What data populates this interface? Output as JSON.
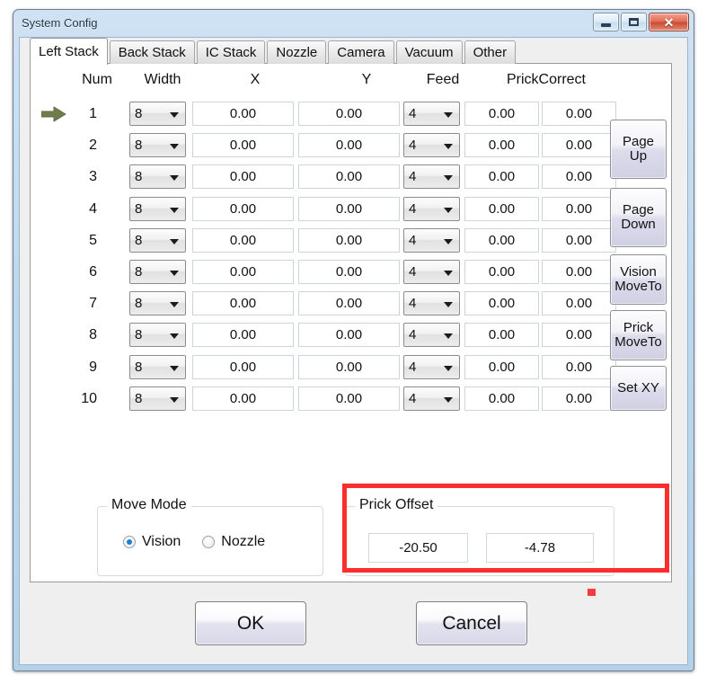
{
  "window": {
    "title": "System Config",
    "controls": {
      "minimize_label": "Minimize",
      "maximize_label": "Maximize",
      "close_label": "✕"
    }
  },
  "tabs": [
    {
      "label": "Left Stack",
      "active": true
    },
    {
      "label": "Back Stack",
      "active": false
    },
    {
      "label": "IC Stack",
      "active": false
    },
    {
      "label": "Nozzle",
      "active": false
    },
    {
      "label": "Camera",
      "active": false
    },
    {
      "label": "Vacuum",
      "active": false
    },
    {
      "label": "Other",
      "active": false
    }
  ],
  "grid": {
    "headers": [
      "Num",
      "Width",
      "X",
      "Y",
      "Feed",
      "PrickCorrect"
    ],
    "selected_row": 1,
    "rows": [
      {
        "num": "1",
        "width": "8",
        "x": "0.00",
        "y": "0.00",
        "feed": "4",
        "prick1": "0.00",
        "prick2": "0.00"
      },
      {
        "num": "2",
        "width": "8",
        "x": "0.00",
        "y": "0.00",
        "feed": "4",
        "prick1": "0.00",
        "prick2": "0.00"
      },
      {
        "num": "3",
        "width": "8",
        "x": "0.00",
        "y": "0.00",
        "feed": "4",
        "prick1": "0.00",
        "prick2": "0.00"
      },
      {
        "num": "4",
        "width": "8",
        "x": "0.00",
        "y": "0.00",
        "feed": "4",
        "prick1": "0.00",
        "prick2": "0.00"
      },
      {
        "num": "5",
        "width": "8",
        "x": "0.00",
        "y": "0.00",
        "feed": "4",
        "prick1": "0.00",
        "prick2": "0.00"
      },
      {
        "num": "6",
        "width": "8",
        "x": "0.00",
        "y": "0.00",
        "feed": "4",
        "prick1": "0.00",
        "prick2": "0.00"
      },
      {
        "num": "7",
        "width": "8",
        "x": "0.00",
        "y": "0.00",
        "feed": "4",
        "prick1": "0.00",
        "prick2": "0.00"
      },
      {
        "num": "8",
        "width": "8",
        "x": "0.00",
        "y": "0.00",
        "feed": "4",
        "prick1": "0.00",
        "prick2": "0.00"
      },
      {
        "num": "9",
        "width": "8",
        "x": "0.00",
        "y": "0.00",
        "feed": "4",
        "prick1": "0.00",
        "prick2": "0.00"
      },
      {
        "num": "10",
        "width": "8",
        "x": "0.00",
        "y": "0.00",
        "feed": "4",
        "prick1": "0.00",
        "prick2": "0.00"
      }
    ]
  },
  "side_buttons": [
    {
      "line1": "Page",
      "line2": "Up"
    },
    {
      "line1": "Page",
      "line2": "Down"
    },
    {
      "line1": "Vision",
      "line2": "MoveTo"
    },
    {
      "line1": "Prick",
      "line2": "MoveTo"
    },
    {
      "line1": "Set XY",
      "line2": ""
    }
  ],
  "move_mode": {
    "title": "Move Mode",
    "options": [
      {
        "label": "Vision",
        "selected": true
      },
      {
        "label": "Nozzle",
        "selected": false
      }
    ]
  },
  "prick_offset": {
    "title": "Prick Offset",
    "value_x": "-20.50",
    "value_y": "-4.78",
    "highlight_color": "#fc2d2d"
  },
  "footer": {
    "ok_label": "OK",
    "cancel_label": "Cancel"
  }
}
